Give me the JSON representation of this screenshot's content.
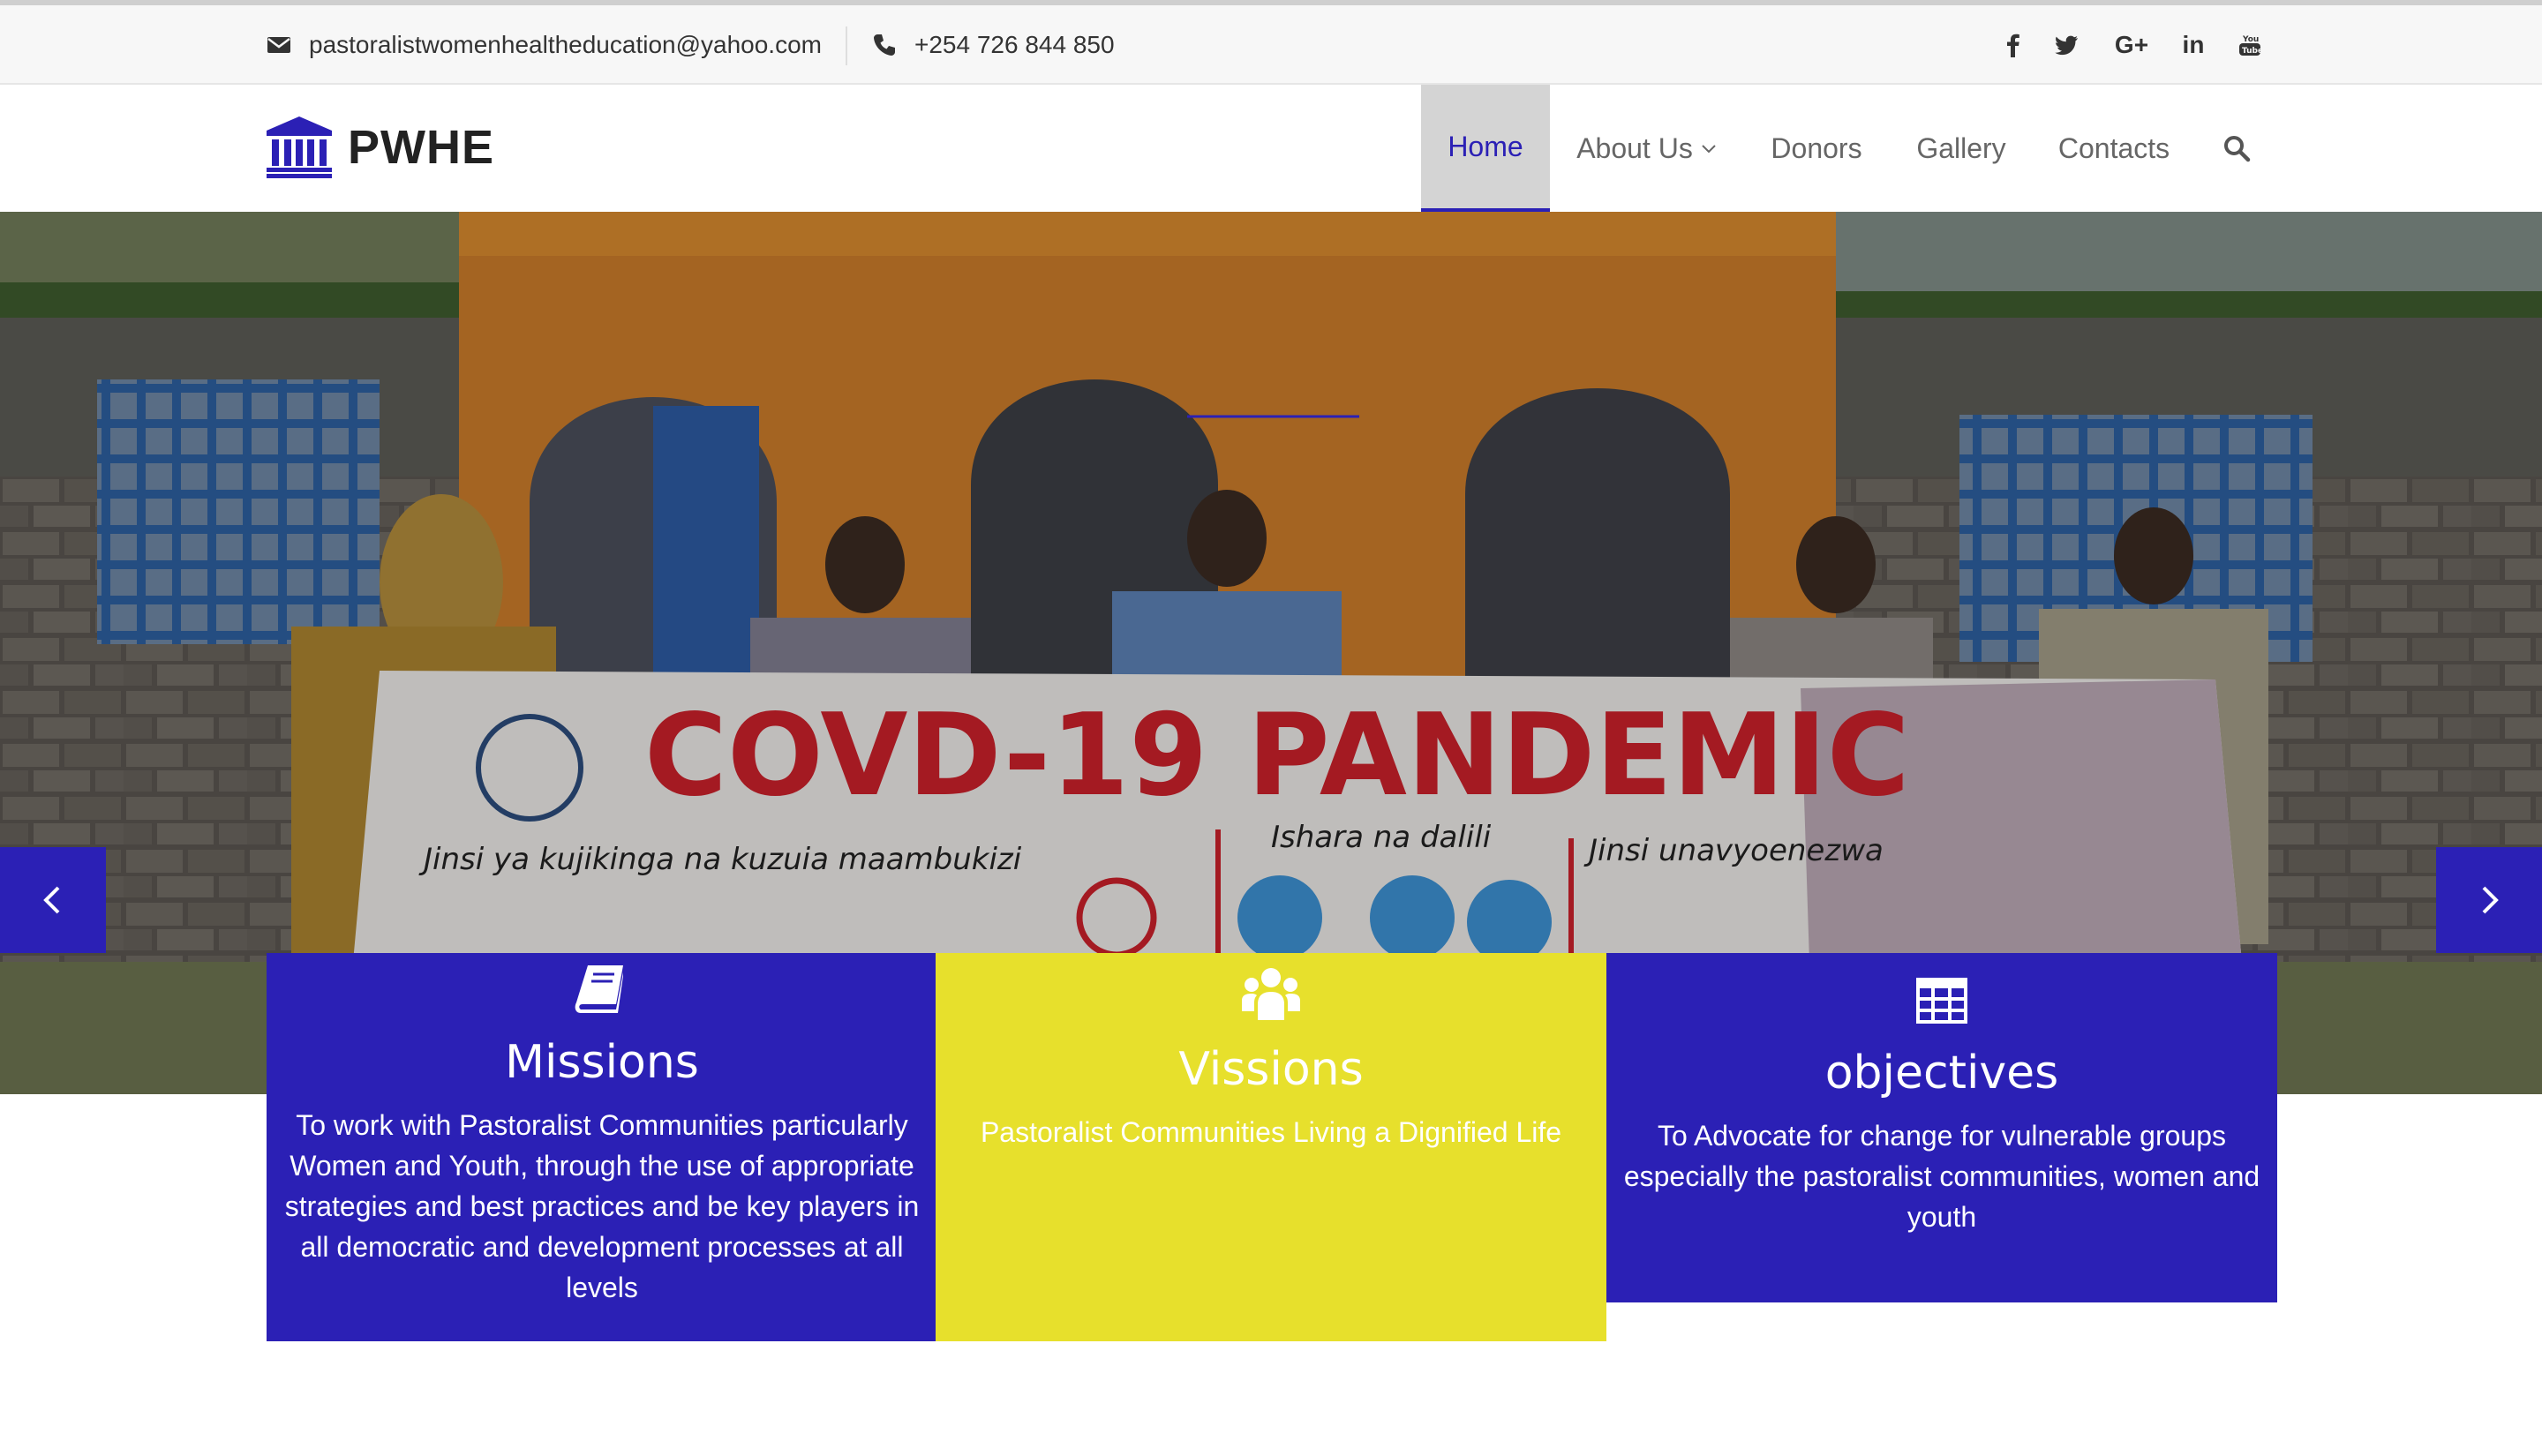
{
  "topbar": {
    "email": "pastoralistwomenhealtheducation@yahoo.com",
    "phone": "+254 726 844 850",
    "email_icon": "envelope-icon",
    "phone_icon": "phone-icon",
    "social": [
      {
        "name": "facebook-icon",
        "glyph": "f"
      },
      {
        "name": "twitter-icon",
        "glyph": ""
      },
      {
        "name": "google-plus-icon",
        "glyph": "G+"
      },
      {
        "name": "linkedin-icon",
        "glyph": "in"
      },
      {
        "name": "youtube-icon",
        "glyph": ""
      }
    ]
  },
  "header": {
    "logo_text": "PWHE",
    "logo_icon": "bank-building-icon",
    "nav": {
      "home": "Home",
      "about": "About Us",
      "donors": "Donors",
      "gallery": "Gallery",
      "contacts": "Contacts"
    },
    "active_nav": "Home",
    "search_icon": "search-icon"
  },
  "hero": {
    "banner": {
      "title": "COVD-19 PANDEMIC",
      "caption_1": "Jinsi ya kujikinga na kuzuia maambukizi",
      "caption_2": "Ishara na dalili",
      "caption_3": "Jinsi unavyoenezwa"
    },
    "prev_icon": "chevron-left-icon",
    "next_icon": "chevron-right-icon"
  },
  "cards": {
    "missions": {
      "title": "Missions",
      "text": "To work with Pastoralist Communities particularly Women and Youth, through the use of appropriate strategies and best practices and be key players in all democratic and development processes at all levels",
      "icon": "book-icon"
    },
    "visions": {
      "title": "Vissions",
      "text": "Pastoralist Communities Living a Dignified Life",
      "icon": "users-icon"
    },
    "objectives": {
      "title": "objectives",
      "text": "To Advocate for change for vulnerable groups especially the pastoralist communities, women and youth",
      "icon": "table-icon"
    }
  },
  "colors": {
    "brand_blue": "#2b20b5",
    "brand_yellow": "#e7e02c",
    "active_nav_bg": "#d4d4d4",
    "banner_red": "#c8202a"
  }
}
